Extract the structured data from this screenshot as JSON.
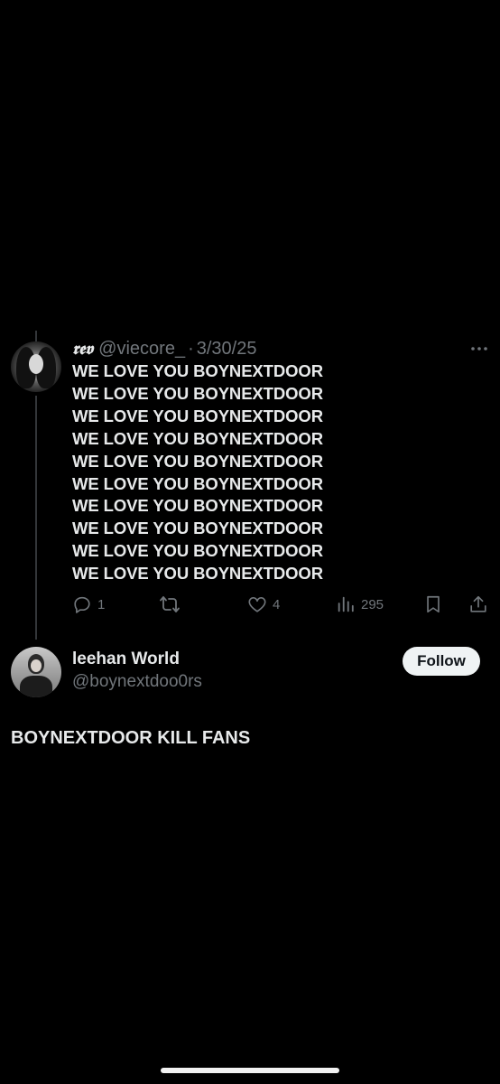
{
  "quoted_post": {
    "display_name": "𝖗𝖊𝖛",
    "handle": "@viecore_",
    "separator": "·",
    "date": "3/30/25",
    "lines": [
      "WE LOVE YOU BOYNEXTDOOR",
      "WE LOVE YOU BOYNEXTDOOR",
      "WE LOVE YOU BOYNEXTDOOR",
      "WE LOVE YOU BOYNEXTDOOR",
      "WE LOVE YOU BOYNEXTDOOR",
      "WE LOVE YOU BOYNEXTDOOR",
      "WE LOVE YOU BOYNEXTDOOR",
      "WE LOVE YOU BOYNEXTDOOR",
      "WE LOVE YOU BOYNEXTDOOR",
      "WE LOVE YOU BOYNEXTDOOR"
    ],
    "actions": {
      "reply_count": "1",
      "retweet_count": "",
      "like_count": "4",
      "view_count": "295"
    },
    "more_icon": "more-horizontal-icon"
  },
  "reply_post": {
    "display_name": "leehan World",
    "handle": "@boynextdoo0rs",
    "follow_label": "Follow",
    "text": "BOYNEXTDOOR KILL FANS"
  },
  "colors": {
    "background": "#000000",
    "text_primary": "#e7e9ea",
    "text_secondary": "#71767b",
    "follow_button_bg": "#eff3f4"
  }
}
